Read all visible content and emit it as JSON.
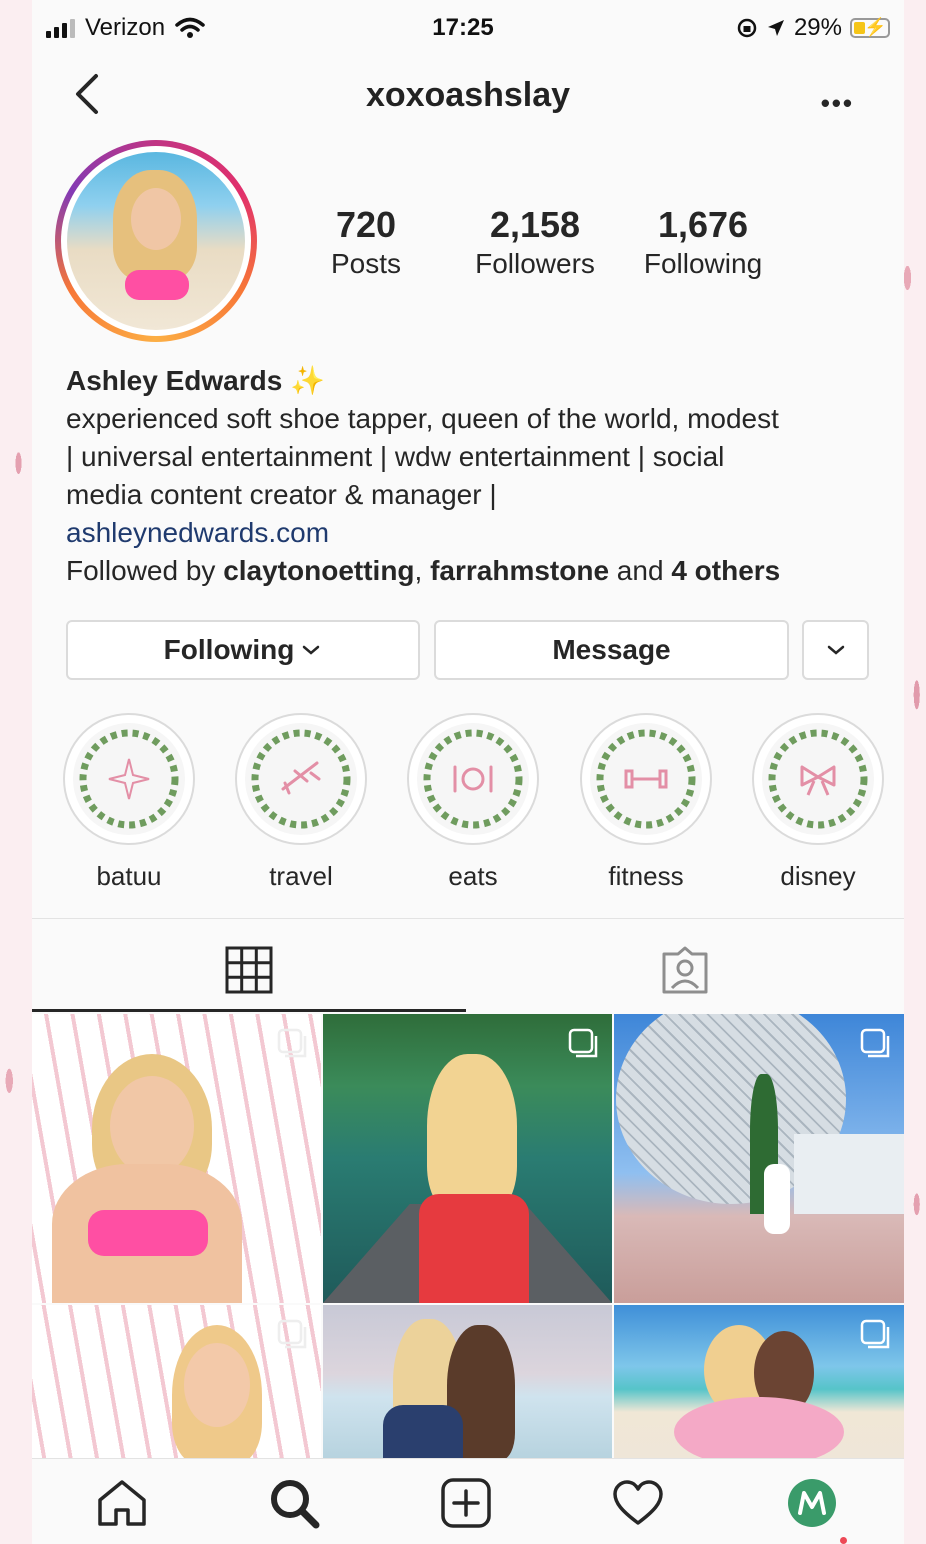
{
  "status_bar": {
    "carrier": "Verizon",
    "time": "17:25",
    "battery": "29%"
  },
  "header": {
    "username": "xoxoashslay"
  },
  "stats": [
    {
      "count": "720",
      "label": "Posts"
    },
    {
      "count": "2,158",
      "label": "Followers"
    },
    {
      "count": "1,676",
      "label": "Following"
    }
  ],
  "bio": {
    "name": "Ashley Edwards",
    "sparkle": "✨",
    "line1": "experienced soft shoe tapper, queen of the world, modest",
    "line2": "| universal entertainment | wdw entertainment | social",
    "line3": "media content creator & manager |",
    "website": "ashleynedwards.com",
    "followed_prefix": "Followed by ",
    "follower1": "claytonoetting",
    "sep": ", ",
    "follower2": "farrahmstone",
    "and": " and ",
    "others": "4 others"
  },
  "buttons": {
    "following": "Following",
    "message": "Message"
  },
  "highlights": [
    {
      "label": "batuu",
      "icon": "sparkle-star-icon"
    },
    {
      "label": "travel",
      "icon": "airplane-icon"
    },
    {
      "label": "eats",
      "icon": "plate-utensils-icon"
    },
    {
      "label": "fitness",
      "icon": "dumbbell-icon"
    },
    {
      "label": "disney",
      "icon": "bow-icon"
    }
  ],
  "tabs": [
    {
      "icon": "grid-icon",
      "active": true
    },
    {
      "icon": "tagged-person-icon",
      "active": false
    }
  ],
  "posts": [
    {
      "desc": "bikini portrait pink",
      "multi": true
    },
    {
      "desc": "canoe in river",
      "multi": true
    },
    {
      "desc": "epcot spaceship earth",
      "multi": true
    },
    {
      "desc": "portrait white background",
      "multi": true
    },
    {
      "desc": "two friends at beach",
      "multi": false
    },
    {
      "desc": "beach with flamingo float",
      "multi": true
    }
  ],
  "bottom_nav": [
    "home-icon",
    "search-icon",
    "new-post-icon",
    "activity-heart-icon",
    "profile-avatar-icon"
  ],
  "colors": {
    "link": "#1f3a6e",
    "text": "#262626",
    "border": "#dbdbdb",
    "notification": "#ed4956"
  }
}
